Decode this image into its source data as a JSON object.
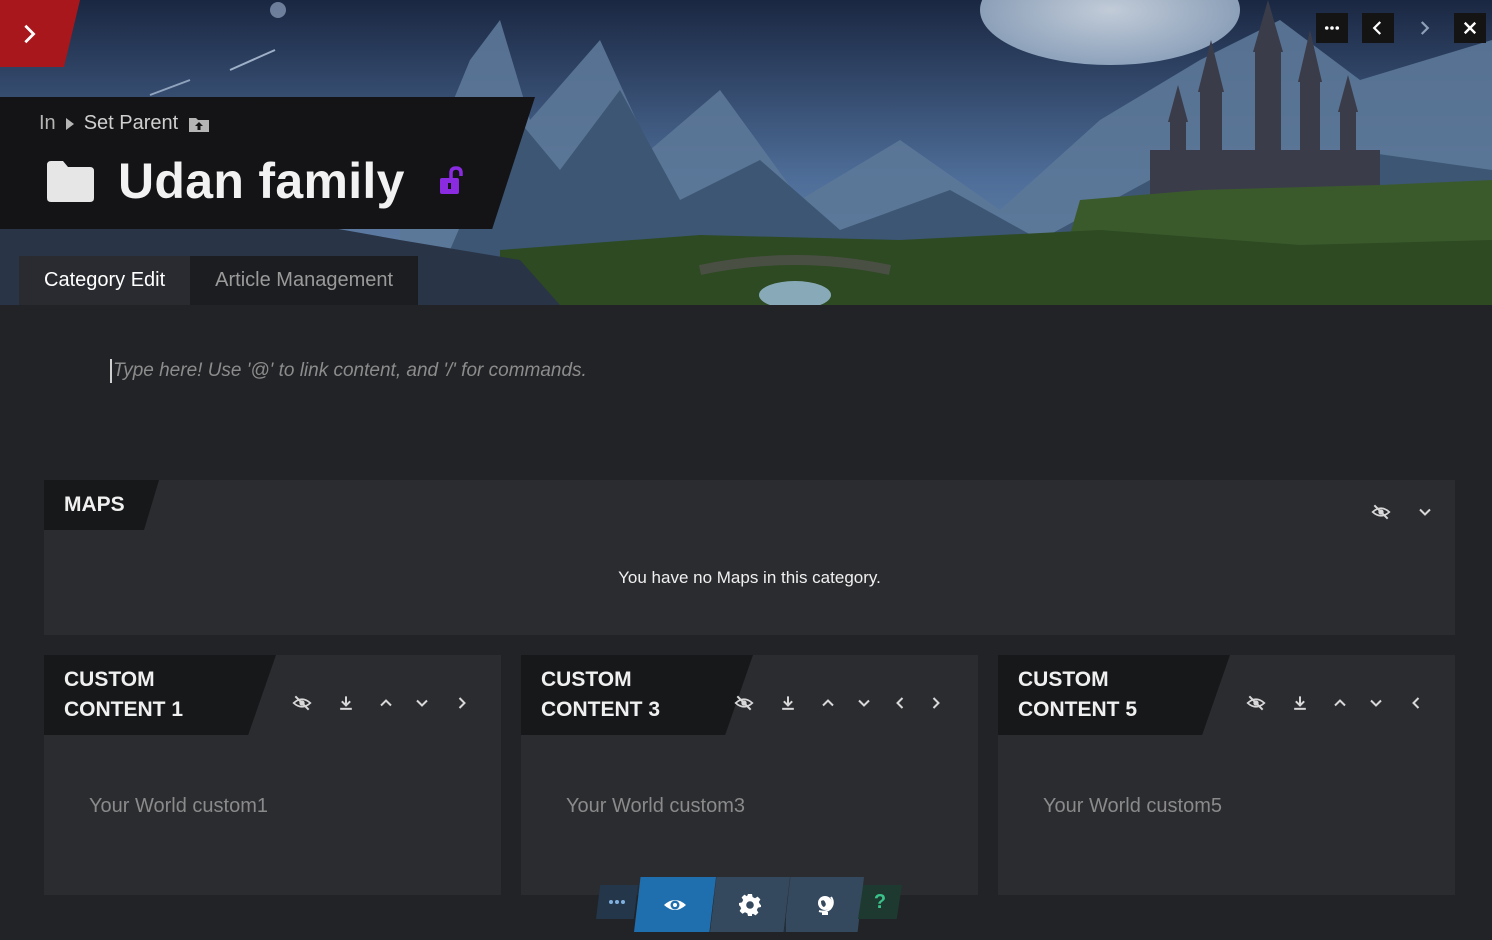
{
  "header": {
    "breadcrumb_in": "In",
    "breadcrumb_parent": "Set Parent",
    "title": "Udan family"
  },
  "tabs": [
    {
      "label": "Category Edit",
      "active": true
    },
    {
      "label": "Article Management",
      "active": false
    }
  ],
  "editor": {
    "placeholder": "Type here! Use '@' to link content, and '/' for commands."
  },
  "maps": {
    "title": "MAPS",
    "empty_text": "You have no Maps in this category."
  },
  "custom_panels": [
    {
      "title": "CUSTOM\nCONTENT 1",
      "placeholder": "Your World custom1"
    },
    {
      "title": "CUSTOM\nCONTENT 3",
      "placeholder": "Your World custom3"
    },
    {
      "title": "CUSTOM\nCONTENT 5",
      "placeholder": "Your World custom5"
    }
  ],
  "bottom_toolbar": {
    "help_label": "?"
  },
  "colors": {
    "accent_red": "#a8171b",
    "lock_purple": "#8a2be2",
    "toolbar_active": "#1f6fae",
    "help_green": "#3ac28a",
    "background": "#222326",
    "panel": "#2b2c30"
  }
}
